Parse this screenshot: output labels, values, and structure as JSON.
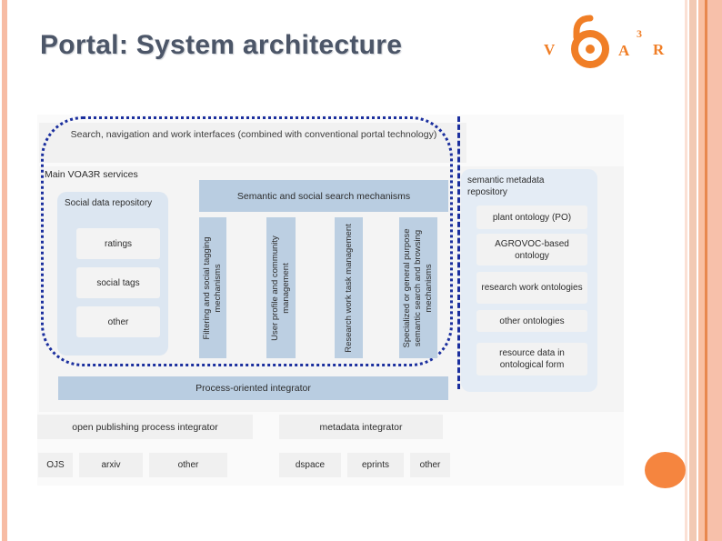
{
  "slide": {
    "title": "Portal: System architecture"
  },
  "logo": {
    "name": "voa3r-logo",
    "letter_v": "V",
    "letter_a": "A",
    "superscript_3": "3",
    "letter_r": "R",
    "mark": "open-access-padlock-icon",
    "color": "#F07E26"
  },
  "diagram": {
    "type": "system-architecture",
    "interface_band": "Search, navigation and work interfaces (combined with conventional portal technology)",
    "main_services_label": "Main VOA3R services",
    "social_data_repository": {
      "header": "Social data repository",
      "items": [
        "ratings",
        "social tags",
        "other"
      ]
    },
    "search_band": "Semantic and social search mechanisms",
    "vertical_columns": [
      "Filtering and social tagging mechanisms",
      "User profile and community management",
      "Research work task management",
      "Specialized or general purpose semantic search and browsing mechanisms"
    ],
    "process_integrator": "Process-oriented integrator",
    "semantic_metadata_repository": {
      "header": "semantic metadata repository",
      "items": [
        "plant ontology (PO)",
        "AGROVOC-based ontology",
        "research work ontologies",
        "other ontologies",
        "resource data in ontological form"
      ]
    },
    "integrators": [
      "open publishing process integrator",
      "metadata integrator"
    ],
    "sources_left": [
      "OJS",
      "arxiv",
      "other"
    ],
    "sources_right": [
      "dspace",
      "eprints",
      "other"
    ],
    "colors": {
      "accent_blue": "#B9CDE1",
      "panel_blue": "#DCE6F1",
      "enclosure_border": "#1B2F9E",
      "box_gray": "#F0F0F0"
    }
  },
  "decor": {
    "stripe_color_1": "#F7BCA4",
    "stripe_color_2": "#E8874E",
    "circle_color": "#F5853F"
  }
}
